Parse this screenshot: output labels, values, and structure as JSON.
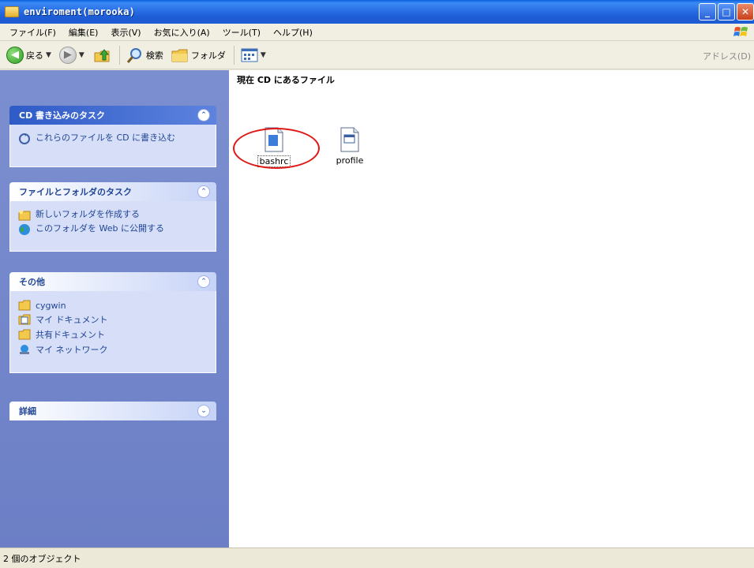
{
  "window": {
    "title": "enviroment(morooka)"
  },
  "title_buttons": {
    "minimize": "_",
    "maximize": "□",
    "close": "✕"
  },
  "menu": [
    "ファイル(F)",
    "編集(E)",
    "表示(V)",
    "お気に入り(A)",
    "ツール(T)",
    "ヘルプ(H)"
  ],
  "toolbar": {
    "back": "戻る",
    "search": "検索",
    "folders": "フォルダ",
    "address": "アドレス(D)"
  },
  "task_pane": {
    "cd_tasks": {
      "title": "CD 書き込みのタスク",
      "items": [
        "これらのファイルを CD に書き込む"
      ]
    },
    "file_tasks": {
      "title": "ファイルとフォルダのタスク",
      "items": [
        "新しいフォルダを作成する",
        "このフォルダを Web に公開する"
      ]
    },
    "other": {
      "title": "その他",
      "items": [
        "cygwin",
        "マイ ドキュメント",
        "共有ドキュメント",
        "マイ ネットワーク"
      ]
    },
    "details": {
      "title": "詳細"
    }
  },
  "content": {
    "group_title": "現在 CD にあるファイル",
    "files": [
      {
        "name": "bashrc",
        "selected": true
      },
      {
        "name": "profile",
        "selected": false
      }
    ]
  },
  "status": {
    "text": "2 個のオブジェクト"
  },
  "colors": {
    "titlebar": "#1D5DD6",
    "taskpane": "#6C7FC6",
    "link": "#214596",
    "highlight": "#E01818"
  }
}
